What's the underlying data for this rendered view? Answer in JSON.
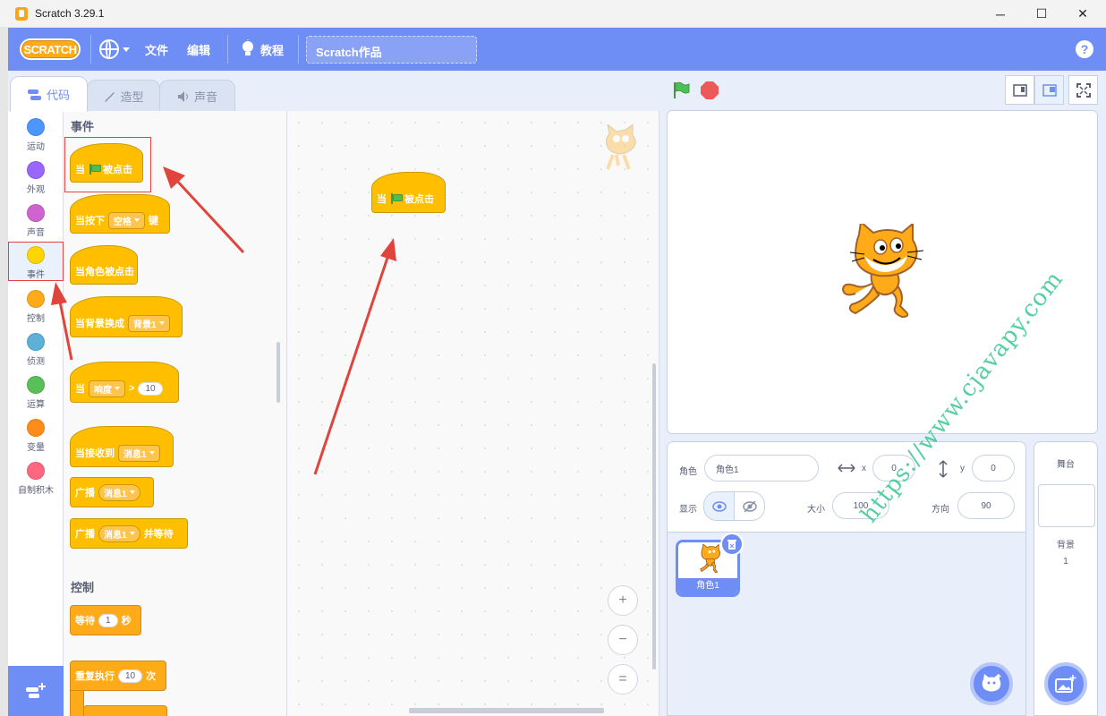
{
  "window": {
    "title": "Scratch 3.29.1",
    "controls": [
      "─",
      "☐",
      "✕"
    ]
  },
  "menubar": {
    "logo_text": "SCRATCH",
    "file": "文件",
    "edit": "编辑",
    "tutorials": "教程",
    "project_title": "Scratch作品",
    "help": "?"
  },
  "tabs": {
    "code": "代码",
    "costumes": "造型",
    "sounds": "声音"
  },
  "categories": [
    {
      "label": "运动",
      "color": "#4c97ff"
    },
    {
      "label": "外观",
      "color": "#9966ff"
    },
    {
      "label": "声音",
      "color": "#cf63cf"
    },
    {
      "label": "事件",
      "color": "#ffd500"
    },
    {
      "label": "控制",
      "color": "#ffab19"
    },
    {
      "label": "侦测",
      "color": "#5cb1d6"
    },
    {
      "label": "运算",
      "color": "#59c059"
    },
    {
      "label": "变量",
      "color": "#ff8c1a"
    },
    {
      "label": "自制积木",
      "color": "#ff6680"
    }
  ],
  "palette": {
    "events_title": "事件",
    "control_title": "控制",
    "when": "当",
    "flag_clicked": "被点击",
    "when_key_pressed": "当按下",
    "key_value": "空格",
    "key_suffix": "键",
    "when_sprite_clicked": "当角色被点击",
    "when_backdrop_switches": "当背景换成",
    "backdrop_value": "背景1",
    "loudness_option": "响度",
    "gt": ">",
    "loudness_value": "10",
    "when_receive": "当接收到",
    "message_value": "消息1",
    "broadcast": "广播",
    "broadcast_wait_suffix": "并等待",
    "wait": "等待",
    "wait_value": "1",
    "seconds": "秒",
    "repeat": "重复执行",
    "repeat_value": "10",
    "times": "次"
  },
  "workspace_block": {
    "when": "当",
    "flag_clicked": "被点击"
  },
  "zoom_controls": {
    "zoom_in": "+",
    "zoom_out": "−",
    "reset": "="
  },
  "sprite_info": {
    "sprite_label": "角色",
    "sprite_name": "角色1",
    "x_label": "x",
    "x_value": "0",
    "y_label": "y",
    "y_value": "0",
    "show_label": "显示",
    "size_label": "大小",
    "size_value": "100",
    "direction_label": "方向",
    "direction_value": "90"
  },
  "sprite_list": [
    {
      "name": "角色1"
    }
  ],
  "stage_panel": {
    "title": "舞台",
    "backdrops_label": "背景",
    "backdrops_count": "1"
  },
  "watermark": "https://www.cjavapy.com",
  "colors": {
    "menu_blue": "#6f8ef5",
    "events_yellow": "#ffbf00",
    "control_orange": "#ffab19",
    "annotation_red": "#e0453d"
  }
}
